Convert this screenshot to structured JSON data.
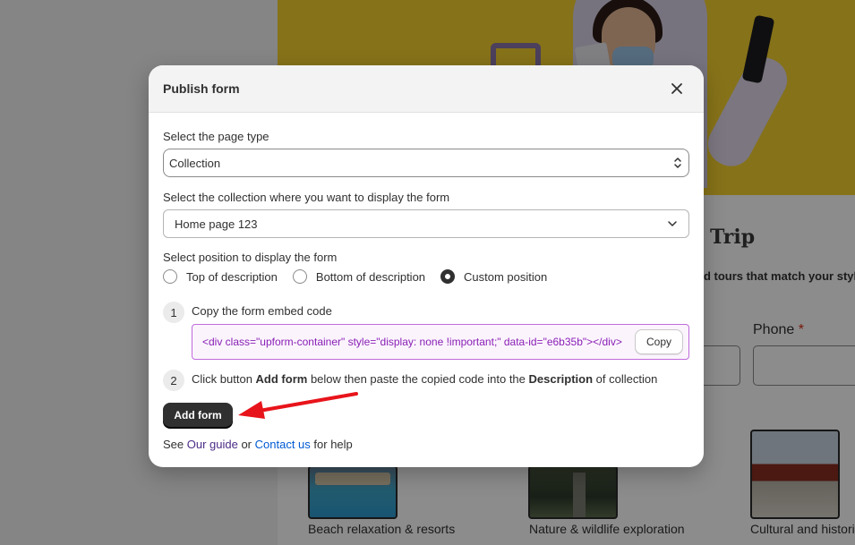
{
  "background": {
    "heading": "Trip",
    "subheading": "nd tours that match your styl",
    "phone_label": "Phone",
    "required_mark": "*",
    "cards": [
      {
        "caption": "Beach relaxation & resorts"
      },
      {
        "caption": "Nature & wildlife exploration"
      },
      {
        "caption": "Cultural and historic"
      }
    ]
  },
  "modal": {
    "title": "Publish form",
    "close_icon": "close-icon",
    "page_type": {
      "label": "Select the page type",
      "value": "Collection"
    },
    "collection": {
      "label": "Select the collection where you want to display the form",
      "value": "Home page 123"
    },
    "position": {
      "label": "Select position to display the form",
      "options": [
        {
          "label": "Top of description",
          "checked": false
        },
        {
          "label": "Bottom of description",
          "checked": false
        },
        {
          "label": "Custom position",
          "checked": true
        }
      ]
    },
    "step1": {
      "number": "1",
      "text": "Copy the form embed code",
      "code": "<div class=\"upform-container\" style=\"display: none !important;\" data-id=\"e6b35b\"></div>",
      "copy_label": "Copy"
    },
    "step2": {
      "number": "2",
      "text_before": "Click button ",
      "text_bold_1": "Add form",
      "text_middle": " below then paste the copied code into the ",
      "text_bold_2": "Description",
      "text_after": " of collection"
    },
    "add_form_label": "Add form",
    "help": {
      "prefix": "See ",
      "guide_link": "Our guide",
      "or": " or ",
      "contact_link": "Contact us",
      "suffix": " for help"
    }
  },
  "colors": {
    "annotation_arrow": "#e8141b",
    "link": "#005bd3",
    "visited_link": "#4b2c86",
    "code_text": "#8a1fb5",
    "code_border": "#c06bdc"
  }
}
